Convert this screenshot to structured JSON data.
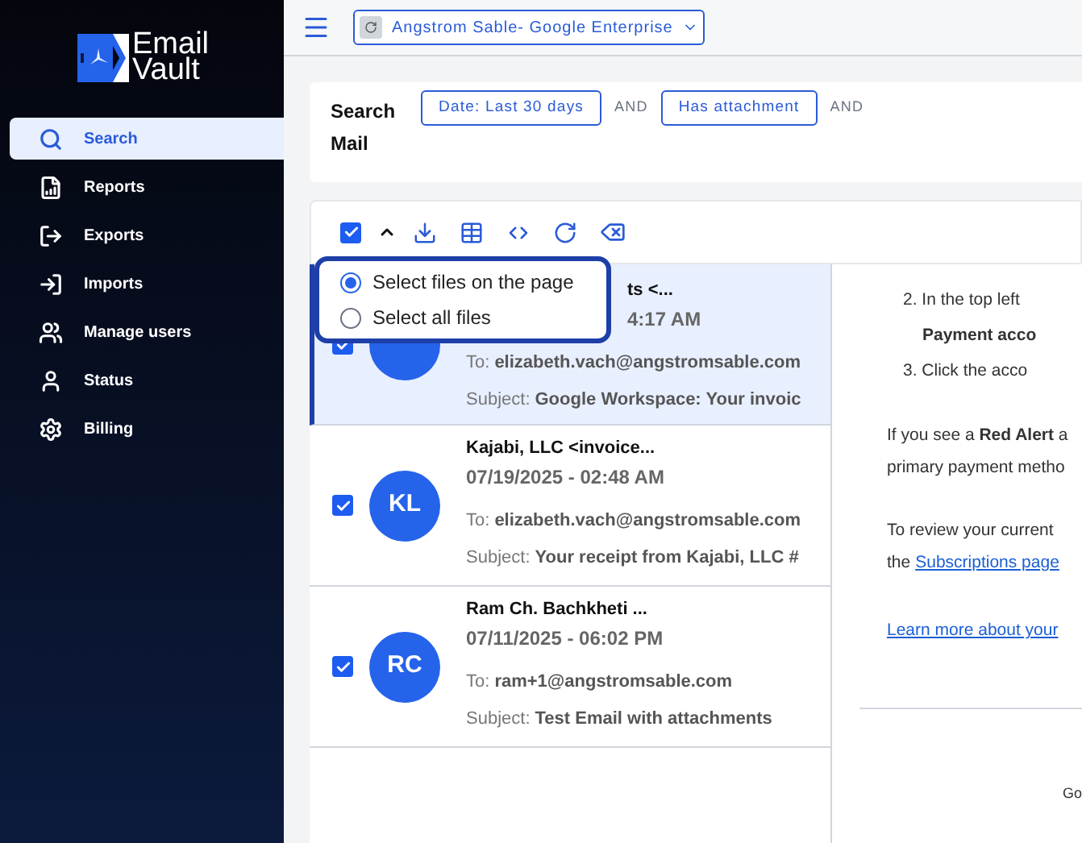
{
  "logo": {
    "line_1": "Email",
    "line_2": "Vault"
  },
  "sidebar": {
    "items": [
      {
        "label": "Search",
        "selected": true
      },
      {
        "label": "Reports",
        "selected": false
      },
      {
        "label": "Exports",
        "selected": false
      },
      {
        "label": "Imports",
        "selected": false
      },
      {
        "label": "Manage users",
        "selected": false
      },
      {
        "label": "Status",
        "selected": false
      },
      {
        "label": "Billing",
        "selected": false
      }
    ]
  },
  "account_selector": {
    "value": "Angstrom Sable- Google Enterprise"
  },
  "search": {
    "title": "Search Mail",
    "filters": [
      {
        "kind": "chip",
        "label": "Date: Last 30 days"
      },
      {
        "kind": "operator",
        "label": "AND"
      },
      {
        "kind": "chip",
        "label": "Has attachment"
      },
      {
        "kind": "operator",
        "label": "AND"
      }
    ]
  },
  "toolbar": {
    "select_all_checked": true
  },
  "select_menu": {
    "options": [
      {
        "label": "Select files on the page",
        "selected": true
      },
      {
        "label": "Select all files",
        "selected": false
      }
    ]
  },
  "emails": [
    {
      "checked": true,
      "selected": true,
      "sender": "ts <...",
      "date": "4:17 AM",
      "to_label": "To:",
      "to": "elizabeth.vach@angstromsable.com",
      "subject_label": "Subject:",
      "subject": "Google Workspace: Your invoic"
    },
    {
      "checked": true,
      "selected": false,
      "initials": "KL",
      "sender": "Kajabi, LLC <invoice...",
      "date": "07/19/2025 - 02:48 AM",
      "to_label": "To:",
      "to": "elizabeth.vach@angstromsable.com",
      "subject_label": "Subject:",
      "subject": "Your receipt from Kajabi, LLC #"
    },
    {
      "checked": true,
      "selected": false,
      "initials": "RC",
      "sender": "Ram Ch. Bachkheti ...",
      "date": "07/11/2025 - 06:02 PM",
      "to_label": "To:",
      "to": "ram+1@angstromsable.com",
      "subject_label": "Subject:",
      "subject": "Test Email with attachments"
    }
  ],
  "preview": {
    "lines": [
      {
        "kind": "numbered",
        "text": "2. In the top left"
      },
      {
        "kind": "indent_bold",
        "text": "Payment acco"
      },
      {
        "kind": "numbered",
        "text": "3. Click the acco"
      },
      {
        "kind": "para",
        "text": "If you see a **Red Alert** a"
      },
      {
        "kind": "para_end",
        "text": "primary payment metho"
      },
      {
        "kind": "para",
        "text": "To review your current"
      },
      {
        "kind": "link_line",
        "text": "the",
        "link": "Subscriptions page"
      },
      {
        "kind": "link",
        "text": "Learn more about your"
      },
      {
        "kind": "rule"
      },
      {
        "kind": "footer",
        "text": "Go"
      }
    ]
  }
}
